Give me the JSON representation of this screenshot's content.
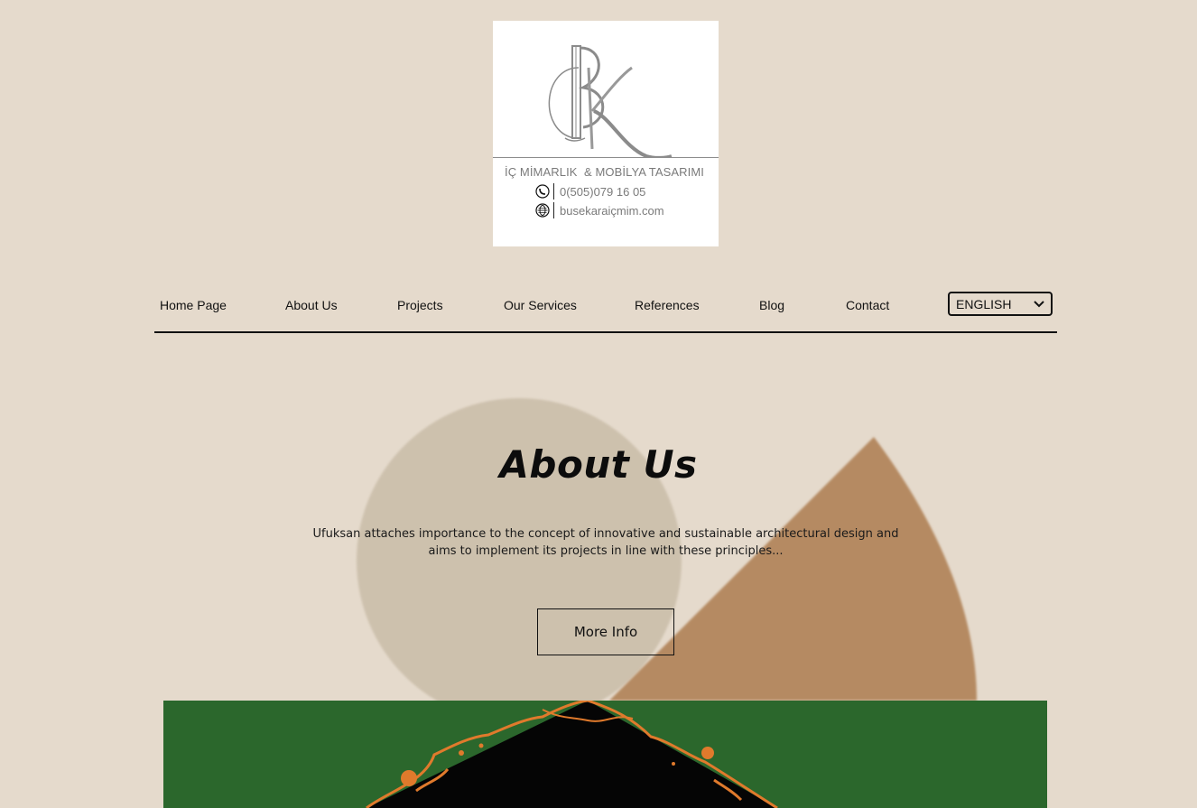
{
  "logo": {
    "tagline": "İÇ MİMARLIK  & MOBİLYA TASARIMI",
    "phone": "0(505)079 16 05",
    "website": "busekaraiçmim.com",
    "icons": [
      "phone-icon",
      "globe-icon"
    ]
  },
  "nav": {
    "items": [
      {
        "label": "Home Page"
      },
      {
        "label": "About Us"
      },
      {
        "label": "Projects"
      },
      {
        "label": "Our Services"
      },
      {
        "label": "References"
      },
      {
        "label": "Blog"
      },
      {
        "label": "Contact"
      }
    ],
    "language": {
      "selected": "ENGLISH",
      "icon": "chevron-down-icon"
    }
  },
  "hero": {
    "title": "About Us",
    "text": "Ufuksan attaches importance to the concept of innovative and sustainable architectural design and aims to implement its projects in line with these principles...",
    "button_label": "More Info"
  },
  "colors": {
    "background": "#e5dacc",
    "circle": "#cdc1ad",
    "wedge": "#b58a62",
    "image_green": "#2b672c",
    "image_accent": "#e07a2c"
  }
}
